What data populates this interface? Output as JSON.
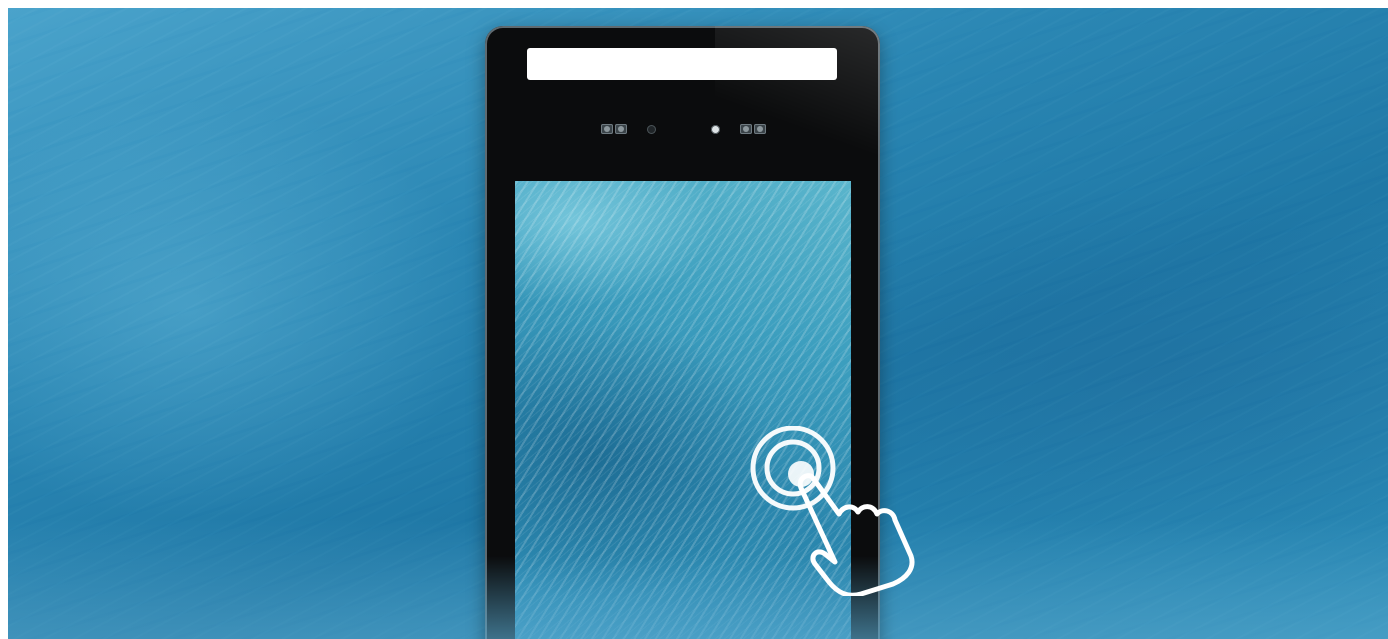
{
  "scene": {
    "background_description_icon": "ocean-wave-background",
    "colors": {
      "ocean_primary": "#2a86b3",
      "device_body": "#0b0c0d",
      "light_bar": "#ffffff",
      "touch_icon": "#ffffff"
    }
  },
  "device": {
    "icons": {
      "light_bar": "light-bar",
      "left_cameras": "dual-camera-icon",
      "right_cameras": "dual-camera-icon",
      "sensor": "sensor-dot-icon",
      "indicator": "indicator-dot-icon",
      "touch": "tap-gesture-icon"
    }
  }
}
